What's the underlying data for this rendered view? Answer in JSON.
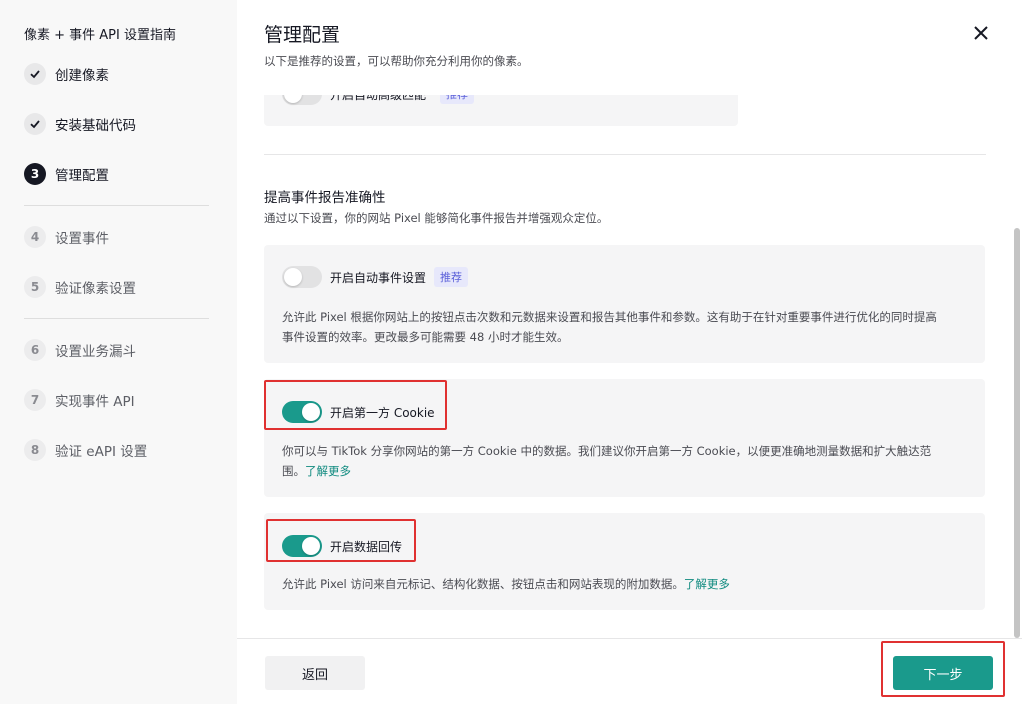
{
  "sidebar": {
    "title": "像素 + 事件 API 设置指南",
    "steps": [
      {
        "badge": "✓",
        "label": "创建像素",
        "state": "done"
      },
      {
        "badge": "✓",
        "label": "安装基础代码",
        "state": "done"
      },
      {
        "badge": "3",
        "label": "管理配置",
        "state": "active"
      },
      {
        "badge": "4",
        "label": "设置事件",
        "state": "pending"
      },
      {
        "badge": "5",
        "label": "验证像素设置",
        "state": "pending"
      },
      {
        "badge": "6",
        "label": "设置业务漏斗",
        "state": "pending"
      },
      {
        "badge": "7",
        "label": "实现事件 API",
        "state": "pending"
      },
      {
        "badge": "8",
        "label": "验证 eAPI 设置",
        "state": "pending"
      }
    ]
  },
  "main": {
    "title": "管理配置",
    "subtitle": "以下是推荐的设置，可以帮助你充分利用你的像素。",
    "top_card": {
      "label": "开启自动高级匹配",
      "badge": "推荐",
      "enabled": false
    },
    "section": {
      "title": "提高事件报告准确性",
      "desc": "通过以下设置，你的网站 Pixel 能够简化事件报告并增强观众定位。"
    },
    "cards": [
      {
        "label": "开启自动事件设置",
        "badge": "推荐",
        "enabled": false,
        "desc_line1": "允许此 Pixel 根据你网站上的按钮点击次数和元数据来设置和报告其他事件和参数。这有助于在针对重要事件进行优化的同时提高",
        "desc_line2": "事件设置的效率。更改最多可能需要 48 小时才能生效。"
      },
      {
        "label": "开启第一方 Cookie",
        "enabled": true,
        "desc_line1": "你可以与 TikTok 分享你网站的第一方 Cookie 中的数据。我们建议你开启第一方 Cookie，以便更准确地测量数据和扩大触达范",
        "desc_line2": "围。",
        "link": "了解更多"
      },
      {
        "label": "开启数据回传",
        "enabled": true,
        "desc_line1": "允许此 Pixel 访问来自元标记、结构化数据、按钮点击和网站表现的附加数据。",
        "link": "了解更多"
      }
    ]
  },
  "footer": {
    "back_label": "返回",
    "next_label": "下一步"
  },
  "colors": {
    "accent": "#1a9a8c",
    "highlight": "#e03131",
    "badge_text": "#5a5fd9"
  },
  "icons": {
    "close": "close-icon",
    "check": "check-icon"
  }
}
